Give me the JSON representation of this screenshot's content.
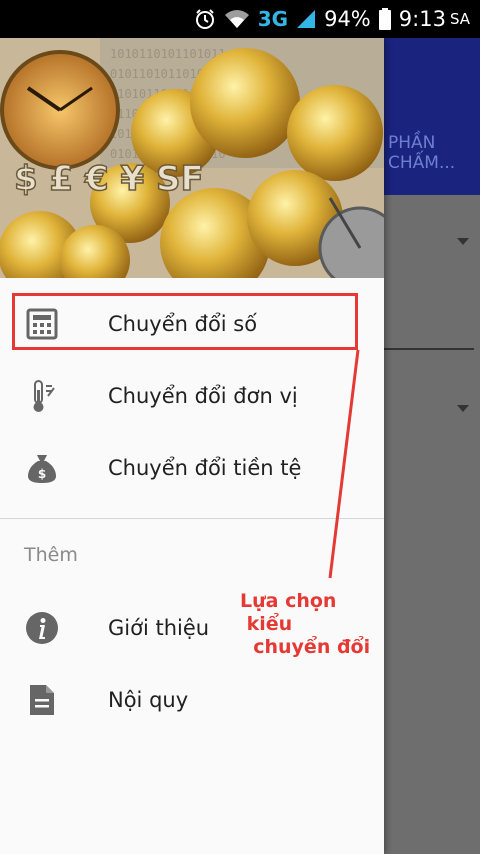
{
  "status_bar": {
    "network": "3G",
    "battery": "94%",
    "time": "9:13",
    "ampm": "SA"
  },
  "background_app": {
    "tab_label_line1": "PHẦN",
    "tab_label_line2": "CHẤM..."
  },
  "header": {
    "currency_symbols": "$ £ € ¥ SF"
  },
  "menu": {
    "items": [
      {
        "label": "Chuyển đổi số",
        "icon": "calculator-icon"
      },
      {
        "label": "Chuyển đổi đơn vị",
        "icon": "thermometer-icon"
      },
      {
        "label": "Chuyển đổi tiền tệ",
        "icon": "money-bag-icon"
      }
    ],
    "section_title": "Thêm",
    "more_items": [
      {
        "label": "Giới thiệu",
        "icon": "info-icon"
      },
      {
        "label": "Nội quy",
        "icon": "document-icon"
      }
    ]
  },
  "annotation": {
    "text": "Lựa chọn\n kiểu\n  chuyển đổi",
    "color": "#e53935"
  }
}
